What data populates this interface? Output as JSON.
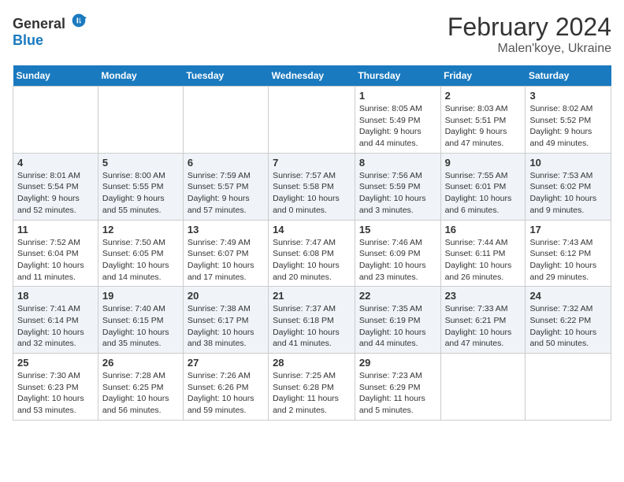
{
  "header": {
    "logo_general": "General",
    "logo_blue": "Blue",
    "title": "February 2024",
    "subtitle": "Malen'koye, Ukraine"
  },
  "weekdays": [
    "Sunday",
    "Monday",
    "Tuesday",
    "Wednesday",
    "Thursday",
    "Friday",
    "Saturday"
  ],
  "weeks": [
    [
      {
        "day": "",
        "info": ""
      },
      {
        "day": "",
        "info": ""
      },
      {
        "day": "",
        "info": ""
      },
      {
        "day": "",
        "info": ""
      },
      {
        "day": "1",
        "info": "Sunrise: 8:05 AM\nSunset: 5:49 PM\nDaylight: 9 hours and 44 minutes."
      },
      {
        "day": "2",
        "info": "Sunrise: 8:03 AM\nSunset: 5:51 PM\nDaylight: 9 hours and 47 minutes."
      },
      {
        "day": "3",
        "info": "Sunrise: 8:02 AM\nSunset: 5:52 PM\nDaylight: 9 hours and 49 minutes."
      }
    ],
    [
      {
        "day": "4",
        "info": "Sunrise: 8:01 AM\nSunset: 5:54 PM\nDaylight: 9 hours and 52 minutes."
      },
      {
        "day": "5",
        "info": "Sunrise: 8:00 AM\nSunset: 5:55 PM\nDaylight: 9 hours and 55 minutes."
      },
      {
        "day": "6",
        "info": "Sunrise: 7:59 AM\nSunset: 5:57 PM\nDaylight: 9 hours and 57 minutes."
      },
      {
        "day": "7",
        "info": "Sunrise: 7:57 AM\nSunset: 5:58 PM\nDaylight: 10 hours and 0 minutes."
      },
      {
        "day": "8",
        "info": "Sunrise: 7:56 AM\nSunset: 5:59 PM\nDaylight: 10 hours and 3 minutes."
      },
      {
        "day": "9",
        "info": "Sunrise: 7:55 AM\nSunset: 6:01 PM\nDaylight: 10 hours and 6 minutes."
      },
      {
        "day": "10",
        "info": "Sunrise: 7:53 AM\nSunset: 6:02 PM\nDaylight: 10 hours and 9 minutes."
      }
    ],
    [
      {
        "day": "11",
        "info": "Sunrise: 7:52 AM\nSunset: 6:04 PM\nDaylight: 10 hours and 11 minutes."
      },
      {
        "day": "12",
        "info": "Sunrise: 7:50 AM\nSunset: 6:05 PM\nDaylight: 10 hours and 14 minutes."
      },
      {
        "day": "13",
        "info": "Sunrise: 7:49 AM\nSunset: 6:07 PM\nDaylight: 10 hours and 17 minutes."
      },
      {
        "day": "14",
        "info": "Sunrise: 7:47 AM\nSunset: 6:08 PM\nDaylight: 10 hours and 20 minutes."
      },
      {
        "day": "15",
        "info": "Sunrise: 7:46 AM\nSunset: 6:09 PM\nDaylight: 10 hours and 23 minutes."
      },
      {
        "day": "16",
        "info": "Sunrise: 7:44 AM\nSunset: 6:11 PM\nDaylight: 10 hours and 26 minutes."
      },
      {
        "day": "17",
        "info": "Sunrise: 7:43 AM\nSunset: 6:12 PM\nDaylight: 10 hours and 29 minutes."
      }
    ],
    [
      {
        "day": "18",
        "info": "Sunrise: 7:41 AM\nSunset: 6:14 PM\nDaylight: 10 hours and 32 minutes."
      },
      {
        "day": "19",
        "info": "Sunrise: 7:40 AM\nSunset: 6:15 PM\nDaylight: 10 hours and 35 minutes."
      },
      {
        "day": "20",
        "info": "Sunrise: 7:38 AM\nSunset: 6:17 PM\nDaylight: 10 hours and 38 minutes."
      },
      {
        "day": "21",
        "info": "Sunrise: 7:37 AM\nSunset: 6:18 PM\nDaylight: 10 hours and 41 minutes."
      },
      {
        "day": "22",
        "info": "Sunrise: 7:35 AM\nSunset: 6:19 PM\nDaylight: 10 hours and 44 minutes."
      },
      {
        "day": "23",
        "info": "Sunrise: 7:33 AM\nSunset: 6:21 PM\nDaylight: 10 hours and 47 minutes."
      },
      {
        "day": "24",
        "info": "Sunrise: 7:32 AM\nSunset: 6:22 PM\nDaylight: 10 hours and 50 minutes."
      }
    ],
    [
      {
        "day": "25",
        "info": "Sunrise: 7:30 AM\nSunset: 6:23 PM\nDaylight: 10 hours and 53 minutes."
      },
      {
        "day": "26",
        "info": "Sunrise: 7:28 AM\nSunset: 6:25 PM\nDaylight: 10 hours and 56 minutes."
      },
      {
        "day": "27",
        "info": "Sunrise: 7:26 AM\nSunset: 6:26 PM\nDaylight: 10 hours and 59 minutes."
      },
      {
        "day": "28",
        "info": "Sunrise: 7:25 AM\nSunset: 6:28 PM\nDaylight: 11 hours and 2 minutes."
      },
      {
        "day": "29",
        "info": "Sunrise: 7:23 AM\nSunset: 6:29 PM\nDaylight: 11 hours and 5 minutes."
      },
      {
        "day": "",
        "info": ""
      },
      {
        "day": "",
        "info": ""
      }
    ]
  ]
}
